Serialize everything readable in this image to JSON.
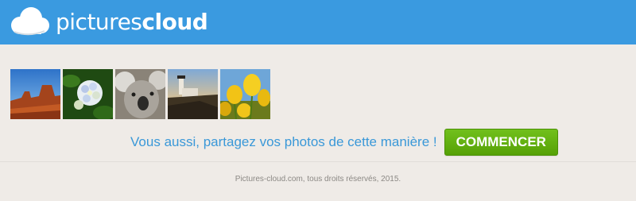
{
  "header": {
    "logo_part1": "pictures",
    "logo_part2": "cloud",
    "background_color": "#3a9ae0",
    "icon": "cloud-icon"
  },
  "gallery": {
    "thumbnails": [
      {
        "subject": "desert-mesa"
      },
      {
        "subject": "hydrangea-flower"
      },
      {
        "subject": "koala"
      },
      {
        "subject": "lighthouse"
      },
      {
        "subject": "yellow-tulips"
      }
    ]
  },
  "cta": {
    "text": "Vous aussi, partagez vos photos de cette manière !",
    "button_label": "COMMENCER",
    "button_color": "#5fae0c",
    "text_color": "#3a98d8"
  },
  "footer": {
    "text": "Pictures-cloud.com, tous droits réservés, 2015."
  }
}
